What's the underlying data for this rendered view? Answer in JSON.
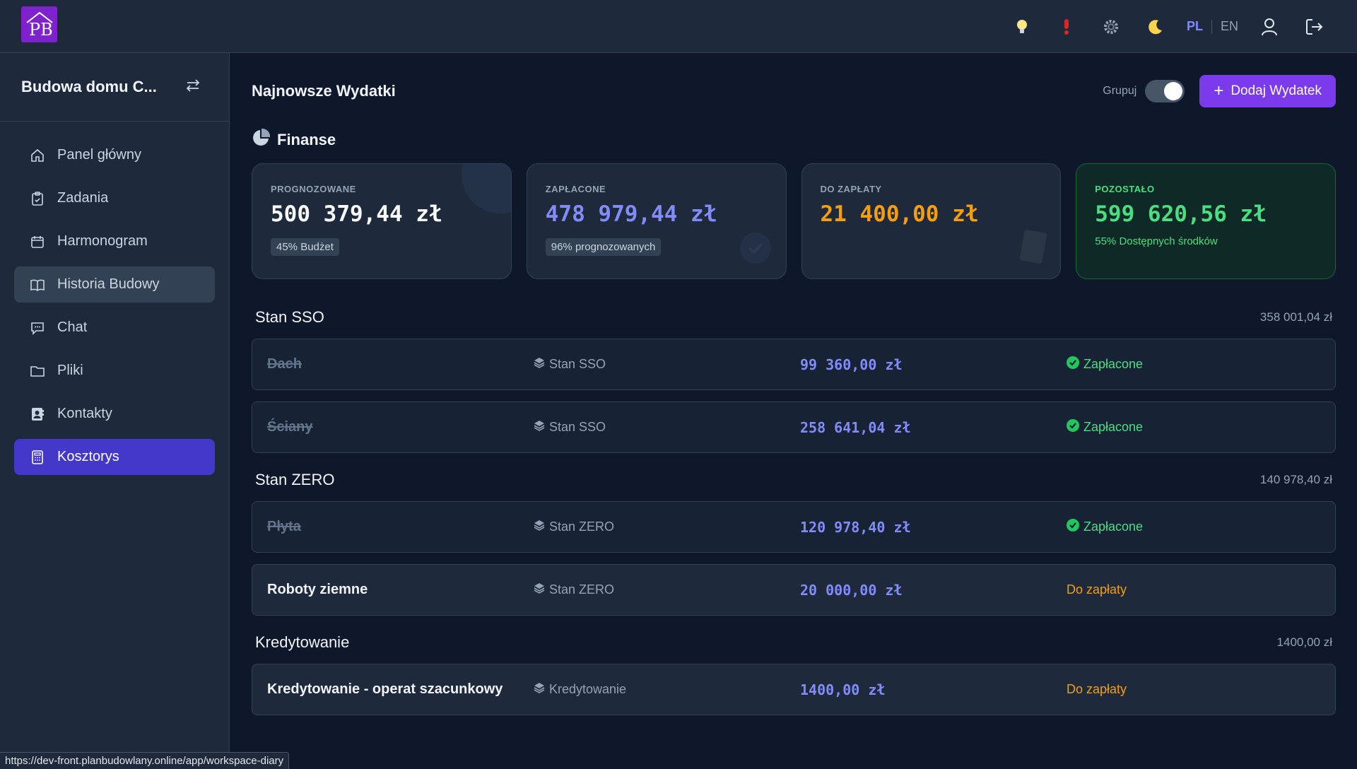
{
  "topbar": {
    "logo_text": "PB",
    "icons": [
      "lightbulb-icon",
      "alert-icon",
      "settings-icon",
      "moon-icon"
    ],
    "lang_active": "PL",
    "lang_inactive": "EN"
  },
  "sidebar": {
    "project_name": "Budowa domu C...",
    "items": [
      {
        "label": "Panel główny",
        "icon": "home-icon"
      },
      {
        "label": "Zadania",
        "icon": "clipboard-icon"
      },
      {
        "label": "Harmonogram",
        "icon": "calendar-icon"
      },
      {
        "label": "Historia Budowy",
        "icon": "book-icon"
      },
      {
        "label": "Chat",
        "icon": "chat-icon"
      },
      {
        "label": "Pliki",
        "icon": "folder-icon"
      },
      {
        "label": "Kontakty",
        "icon": "contacts-icon"
      },
      {
        "label": "Kosztorys",
        "icon": "calculator-icon"
      }
    ]
  },
  "main": {
    "title": "Najnowsze Wydatki",
    "group_label": "Grupuj",
    "add_button": "Dodaj Wydatek",
    "finance_title": "Finanse",
    "cards": [
      {
        "label": "PROGNOZOWANE",
        "value": "500 379,44 zł",
        "badge": "45% Budżet",
        "color": "#f8fafc"
      },
      {
        "label": "ZAPŁACONE",
        "value": "478 979,44 zł",
        "badge": "96% prognozowanych",
        "color": "#818cf8"
      },
      {
        "label": "DO ZAPŁATY",
        "value": "21 400,00 zł",
        "color": "#f59e0b"
      },
      {
        "label": "POZOSTAŁO",
        "value": "599 620,56 zł",
        "note": "55% Dostępnych środków",
        "color": "#4ade80"
      }
    ],
    "groups": [
      {
        "name": "Stan SSO",
        "total": "358 001,04 zł",
        "rows": [
          {
            "name": "Dach",
            "category": "Stan SSO",
            "amount": "99 360,00 zł",
            "status": "Zapłacone"
          },
          {
            "name": "Ściany",
            "category": "Stan SSO",
            "amount": "258 641,04 zł",
            "status": "Zapłacone"
          }
        ]
      },
      {
        "name": "Stan ZERO",
        "total": "140 978,40 zł",
        "rows": [
          {
            "name": "Płyta",
            "category": "Stan ZERO",
            "amount": "120 978,40 zł",
            "status": "Zapłacone"
          },
          {
            "name": "Roboty ziemne",
            "category": "Stan ZERO",
            "amount": "20 000,00 zł",
            "status": "Do zapłaty"
          }
        ]
      },
      {
        "name": "Kredytowanie",
        "total": "1400,00 zł",
        "rows": [
          {
            "name": "Kredytowanie - operat szacunkowy",
            "category": "Kredytowanie",
            "amount": "1400,00 zł",
            "status": "Do zapłaty"
          }
        ]
      }
    ]
  },
  "statusbar": {
    "url": "https://dev-front.planbudowlany.online/app/workspace-diary"
  }
}
